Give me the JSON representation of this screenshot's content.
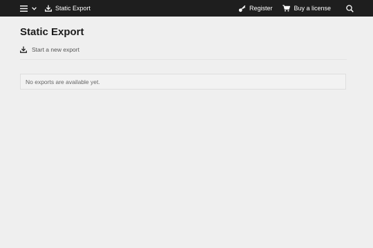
{
  "topbar": {
    "nav_label": "Static Export",
    "register_label": "Register",
    "license_label": "Buy a license"
  },
  "icons": {
    "menu": "hamburger-icon",
    "chevron": "chevron-down-icon",
    "export": "download-icon",
    "register": "key-icon",
    "license": "cart-icon",
    "search": "search-icon"
  },
  "main": {
    "title": "Static Export",
    "new_export_label": "Start a new export",
    "empty_message": "No exports are available yet."
  }
}
